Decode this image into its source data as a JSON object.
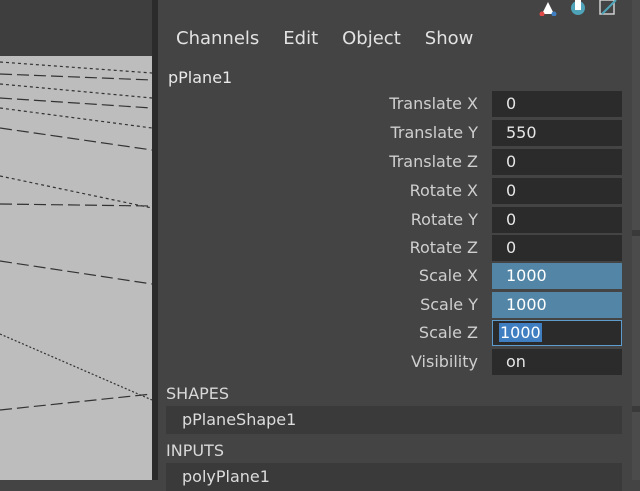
{
  "menu": [
    "Channels",
    "Edit",
    "Object",
    "Show"
  ],
  "node_name": "pPlane1",
  "attributes": [
    {
      "label": "Translate X",
      "value": "0"
    },
    {
      "label": "Translate Y",
      "value": "550"
    },
    {
      "label": "Translate Z",
      "value": "0"
    },
    {
      "label": "Rotate X",
      "value": "0"
    },
    {
      "label": "Rotate Y",
      "value": "0"
    },
    {
      "label": "Rotate Z",
      "value": "0"
    },
    {
      "label": "Scale X",
      "value": "1000"
    },
    {
      "label": "Scale Y",
      "value": "1000"
    },
    {
      "label": "Scale Z",
      "value": "1000"
    },
    {
      "label": "Visibility",
      "value": "on"
    }
  ],
  "shapes_header": "SHAPES",
  "shape_item": "pPlaneShape1",
  "inputs_header": "INPUTS",
  "input_item": "polyPlane1",
  "colors": {
    "selected_field": "#5285a6",
    "field_bg": "#2b2b2b",
    "panel_bg": "#444444",
    "viewport_bg": "#bdbdbd"
  },
  "icons": [
    "channel-box-icon",
    "attribute-editor-icon",
    "tool-settings-icon"
  ]
}
